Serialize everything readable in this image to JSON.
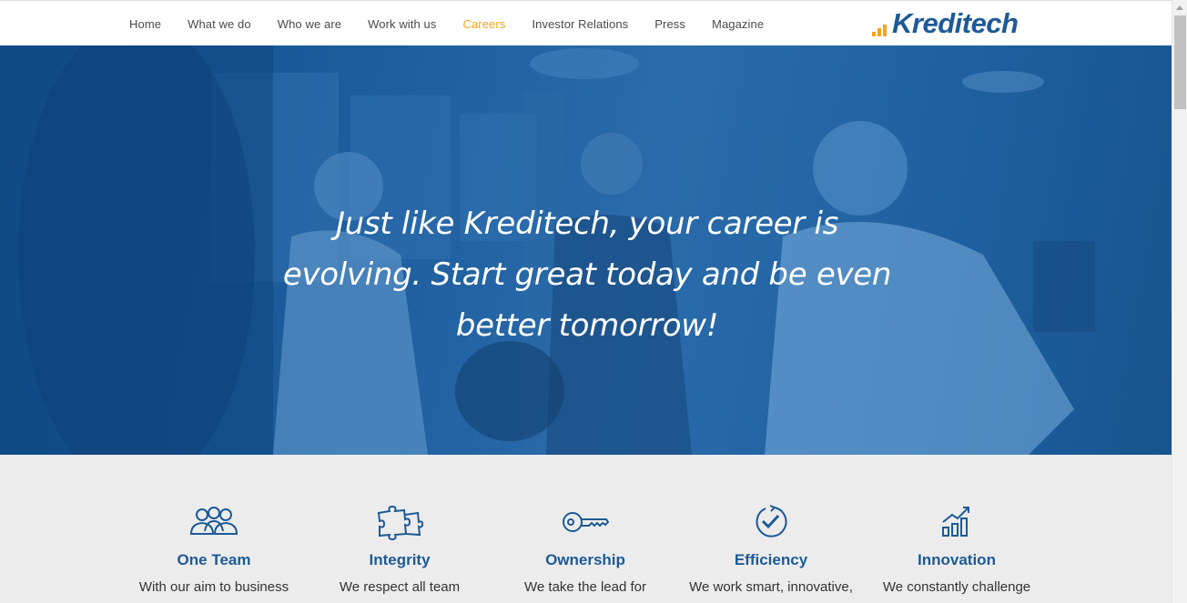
{
  "nav": {
    "items": [
      {
        "label": "Home",
        "active": false
      },
      {
        "label": "What we do",
        "active": false
      },
      {
        "label": "Who we are",
        "active": false
      },
      {
        "label": "Work with us",
        "active": false
      },
      {
        "label": "Careers",
        "active": true
      },
      {
        "label": "Investor Relations",
        "active": false
      },
      {
        "label": "Press",
        "active": false
      },
      {
        "label": "Magazine",
        "active": false
      }
    ]
  },
  "logo": {
    "text": "Kreditech"
  },
  "hero": {
    "line1": "Just like Kreditech, your career is",
    "line2": "evolving. Start great today and be even",
    "line3": "better tomorrow!"
  },
  "values": [
    {
      "icon": "team-icon",
      "title": "One Team",
      "desc": "With our aim to business"
    },
    {
      "icon": "puzzle-icon",
      "title": "Integrity",
      "desc": "We respect all team"
    },
    {
      "icon": "key-icon",
      "title": "Ownership",
      "desc": "We take the lead for"
    },
    {
      "icon": "clock-check-icon",
      "title": "Efficiency",
      "desc": "We work smart, innovative,"
    },
    {
      "icon": "growth-chart-icon",
      "title": "Innovation",
      "desc": "We constantly challenge"
    }
  ],
  "colors": {
    "brand_blue": "#1d5a96",
    "accent_orange": "#f6a31b",
    "hero_overlay": "#1d5d9d"
  }
}
